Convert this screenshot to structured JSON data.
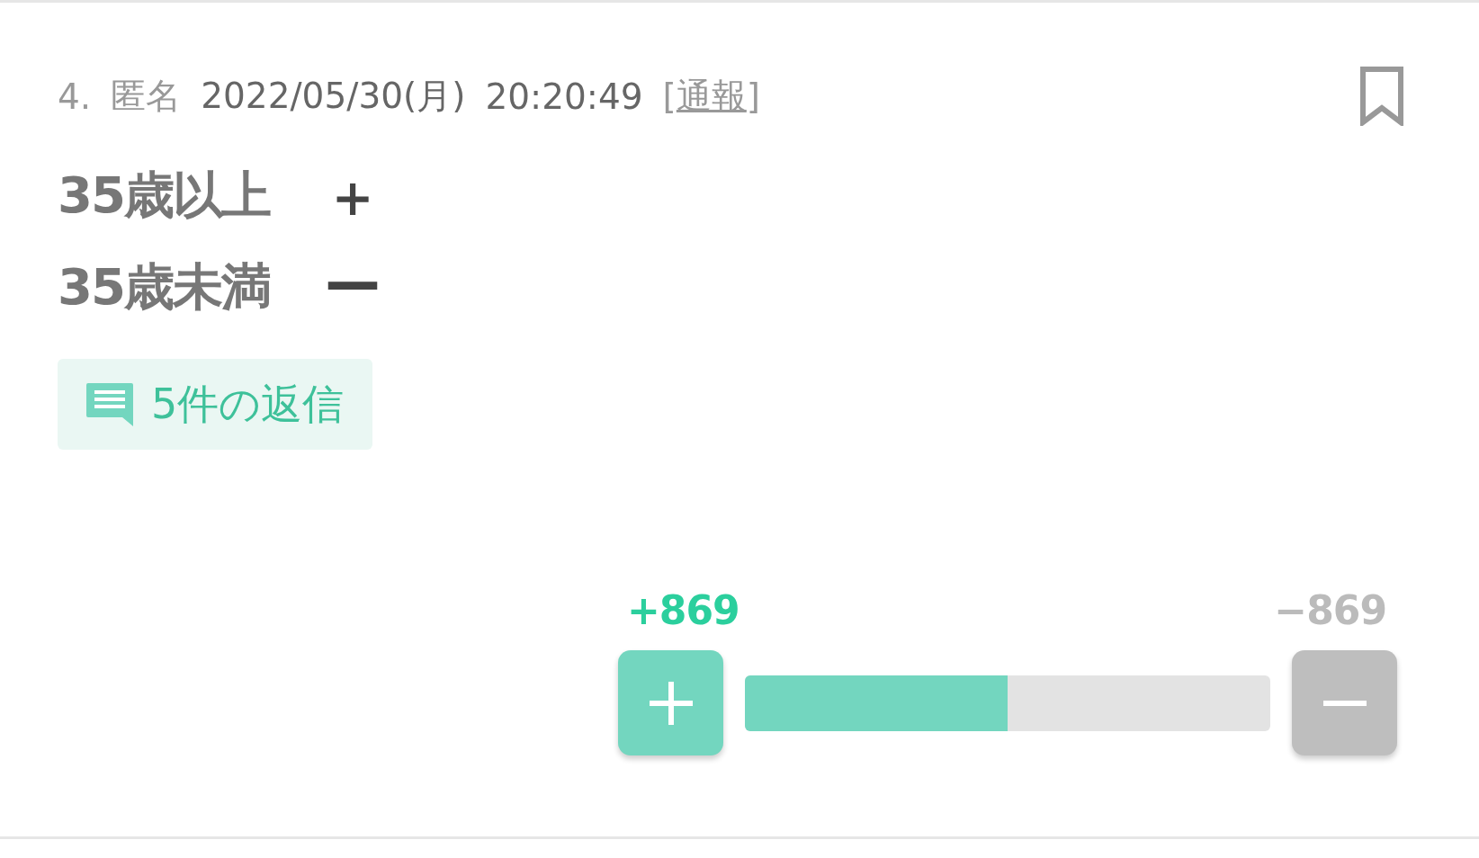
{
  "post": {
    "number": "4.",
    "author": "匿名",
    "date": "2022/05/30(月)",
    "time": "20:20:49",
    "report_open": "[",
    "report_link": "通報",
    "report_close": "]",
    "bookmarked": false,
    "body": [
      {
        "text": "35歳以上",
        "sign": "＋"
      },
      {
        "text": "35歳未満",
        "sign": "ー"
      }
    ],
    "replies": "5件の返信",
    "vote": {
      "plus_count": "+869",
      "minus_count": "−869",
      "level": 0.5
    }
  }
}
